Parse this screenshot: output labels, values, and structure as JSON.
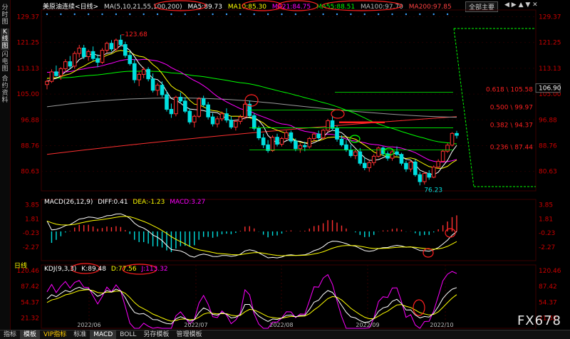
{
  "sidebar": {
    "items": [
      "分时图",
      "K线图",
      "闪电图",
      "合约资料"
    ]
  },
  "header": {
    "title": "美原油连续<日线>",
    "ma_title": "MA(5,10,21,55,100,200)",
    "ma5": "MA5:89.73",
    "ma10": "MA10:85.30",
    "ma21": "MA21:84.75",
    "ma55": "MA55:88.51",
    "ma100": "MA100:97.70",
    "ma200": "MA200:97.85"
  },
  "controls": {
    "main_button": "全部主要",
    "buttons": "◀ ▶ ▲ ▼ ✕"
  },
  "colors": {
    "ma5": "#ffffff",
    "ma10": "#ffff00",
    "ma21": "#ff00ff",
    "ma55": "#00ff00",
    "ma100": "#9a9a9a",
    "ma200": "#ff3030",
    "up": "#ff3030",
    "down": "#00e0e0",
    "annotation": "#ff2020",
    "fib_line": "#00ff00",
    "axis": "#cc0000"
  },
  "macd": {
    "title": "MACD(26,12,9)",
    "diff": "DIFF:0.41",
    "dea": "DEA:-1.23",
    "macd": "MACD:3.27"
  },
  "kdj": {
    "title": "KDJ(9,3,3)",
    "k": "K:89.48",
    "d": "D:77.56",
    "j": "J:113.32"
  },
  "day_tab": "日线",
  "bottom_bar": [
    "指标",
    "模板",
    "VIP指标",
    "标准",
    "MACD",
    "BOLL",
    "另存模板",
    "管理模板"
  ],
  "watermark": "FX678",
  "chart_data": {
    "type": "candlestick",
    "price_axis": {
      "ticks": [
        129.37,
        121.25,
        113.13,
        105.0,
        96.88,
        88.76,
        80.63
      ],
      "range": [
        74.5,
        131.5
      ]
    },
    "last_price": 106.9,
    "date_labels": [
      "2022/06",
      "2022/07",
      "2022/08",
      "2022/09",
      "2022/10"
    ],
    "annotations": {
      "high": "123.68",
      "low": "76.23"
    },
    "fibonacci": [
      {
        "label": "0.618 \\ 105.58",
        "value": 105.58
      },
      {
        "label": "0.500 \\ 99.97",
        "value": 99.97
      },
      {
        "label": "0.382 \\ 94.37",
        "value": 94.37
      },
      {
        "label": "0.236 \\ 87.44",
        "value": 87.44
      }
    ],
    "candles": [
      [
        108.0,
        109.5,
        106.5,
        109.0
      ],
      [
        109.0,
        112.8,
        108.5,
        112.0
      ],
      [
        112.0,
        114.0,
        110.5,
        110.8
      ],
      [
        110.8,
        113.5,
        109.5,
        113.0
      ],
      [
        113.0,
        116.0,
        112.0,
        115.2
      ],
      [
        115.2,
        117.0,
        113.0,
        113.8
      ],
      [
        113.8,
        118.5,
        113.0,
        117.8
      ],
      [
        117.8,
        120.5,
        116.5,
        119.5
      ],
      [
        119.5,
        120.5,
        116.0,
        116.8
      ],
      [
        116.8,
        119.0,
        115.5,
        118.4
      ],
      [
        118.4,
        120.0,
        115.5,
        116.2
      ],
      [
        116.2,
        117.5,
        113.5,
        115.0
      ],
      [
        115.0,
        119.5,
        114.5,
        118.8
      ],
      [
        118.8,
        121.5,
        118.0,
        121.0
      ],
      [
        121.0,
        122.0,
        118.5,
        119.2
      ],
      [
        119.2,
        122.5,
        118.5,
        122.0
      ],
      [
        122.0,
        123.68,
        120.0,
        120.6
      ],
      [
        120.6,
        121.5,
        116.5,
        117.2
      ],
      [
        117.2,
        118.5,
        114.0,
        114.6
      ],
      [
        114.6,
        116.0,
        108.5,
        109.5
      ],
      [
        109.5,
        112.0,
        107.5,
        111.2
      ],
      [
        111.2,
        113.5,
        110.0,
        112.8
      ],
      [
        112.8,
        113.5,
        109.0,
        109.8
      ],
      [
        109.8,
        111.5,
        105.5,
        106.2
      ],
      [
        106.2,
        108.5,
        104.5,
        107.8
      ],
      [
        107.8,
        109.0,
        104.0,
        104.8
      ],
      [
        104.8,
        106.0,
        99.5,
        100.2
      ],
      [
        100.2,
        102.0,
        97.5,
        98.8
      ],
      [
        98.8,
        104.5,
        98.0,
        104.0
      ],
      [
        104.0,
        105.5,
        102.0,
        102.8
      ],
      [
        102.8,
        104.0,
        99.0,
        99.6
      ],
      [
        99.6,
        100.5,
        95.5,
        96.2
      ],
      [
        96.2,
        98.5,
        94.5,
        98.0
      ],
      [
        98.0,
        104.0,
        97.5,
        103.5
      ],
      [
        103.5,
        104.5,
        101.0,
        101.6
      ],
      [
        101.6,
        102.5,
        97.0,
        97.8
      ],
      [
        97.8,
        99.0,
        94.8,
        95.6
      ],
      [
        95.6,
        98.0,
        94.5,
        97.2
      ],
      [
        97.2,
        99.5,
        96.5,
        98.8
      ],
      [
        98.8,
        100.5,
        96.0,
        96.8
      ],
      [
        96.8,
        98.0,
        94.0,
        94.6
      ],
      [
        94.6,
        97.0,
        93.5,
        96.4
      ],
      [
        96.4,
        98.5,
        95.5,
        97.8
      ],
      [
        97.8,
        102.5,
        97.0,
        101.8
      ],
      [
        101.8,
        103.0,
        97.5,
        98.2
      ],
      [
        98.2,
        99.0,
        93.5,
        94.2
      ],
      [
        94.2,
        95.0,
        90.5,
        91.2
      ],
      [
        91.2,
        92.5,
        88.0,
        89.0
      ],
      [
        89.0,
        90.5,
        86.5,
        87.2
      ],
      [
        87.2,
        92.0,
        86.8,
        91.4
      ],
      [
        91.4,
        92.5,
        88.5,
        89.2
      ],
      [
        89.2,
        91.5,
        88.5,
        91.0
      ],
      [
        91.0,
        93.5,
        90.5,
        92.8
      ],
      [
        92.8,
        93.5,
        89.5,
        90.2
      ],
      [
        90.2,
        91.0,
        87.0,
        87.8
      ],
      [
        87.8,
        89.5,
        86.5,
        88.8
      ],
      [
        88.8,
        90.0,
        87.0,
        88.4
      ],
      [
        88.4,
        91.5,
        87.8,
        91.0
      ],
      [
        91.0,
        93.0,
        90.0,
        92.4
      ],
      [
        92.4,
        93.5,
        90.5,
        91.2
      ],
      [
        91.2,
        94.0,
        90.8,
        93.6
      ],
      [
        93.6,
        97.2,
        93.0,
        96.6
      ],
      [
        96.6,
        98.0,
        93.5,
        94.2
      ],
      [
        94.2,
        95.0,
        90.0,
        90.8
      ],
      [
        90.8,
        92.0,
        88.5,
        89.0
      ],
      [
        89.0,
        90.5,
        86.8,
        87.4
      ],
      [
        87.4,
        89.0,
        85.0,
        85.6
      ],
      [
        85.6,
        87.5,
        84.5,
        86.8
      ],
      [
        86.8,
        88.0,
        82.5,
        83.2
      ],
      [
        83.2,
        85.0,
        81.0,
        81.8
      ],
      [
        81.8,
        84.0,
        80.5,
        83.4
      ],
      [
        83.4,
        86.0,
        82.5,
        85.4
      ],
      [
        85.4,
        88.5,
        85.0,
        88.0
      ],
      [
        88.0,
        88.5,
        85.5,
        86.2
      ],
      [
        86.2,
        87.0,
        84.0,
        84.8
      ],
      [
        84.8,
        87.5,
        84.0,
        86.8
      ],
      [
        86.8,
        88.5,
        85.5,
        86.0
      ],
      [
        86.0,
        86.5,
        82.5,
        83.2
      ],
      [
        83.2,
        84.0,
        80.5,
        81.4
      ],
      [
        81.4,
        84.0,
        80.5,
        83.6
      ],
      [
        83.6,
        84.5,
        79.0,
        79.6
      ],
      [
        79.6,
        80.5,
        76.23,
        77.4
      ],
      [
        77.4,
        80.5,
        76.5,
        80.0
      ],
      [
        80.0,
        81.0,
        78.0,
        78.8
      ],
      [
        78.8,
        82.5,
        78.5,
        82.0
      ],
      [
        82.0,
        84.5,
        81.5,
        83.8
      ],
      [
        83.8,
        87.5,
        83.5,
        87.0
      ],
      [
        87.0,
        89.5,
        86.5,
        88.9
      ],
      [
        88.9,
        93.0,
        88.5,
        92.6
      ],
      [
        92.6,
        93.4,
        91.0,
        92.0
      ]
    ],
    "macd_axis": {
      "ticks": [
        3.85,
        1.81,
        -0.23,
        -2.27
      ],
      "range": [
        -4.2,
        4.6
      ]
    },
    "kdj_axis": {
      "ticks": [
        120.46,
        87.42,
        54.37,
        21.32
      ],
      "range": [
        0,
        132
      ]
    }
  }
}
